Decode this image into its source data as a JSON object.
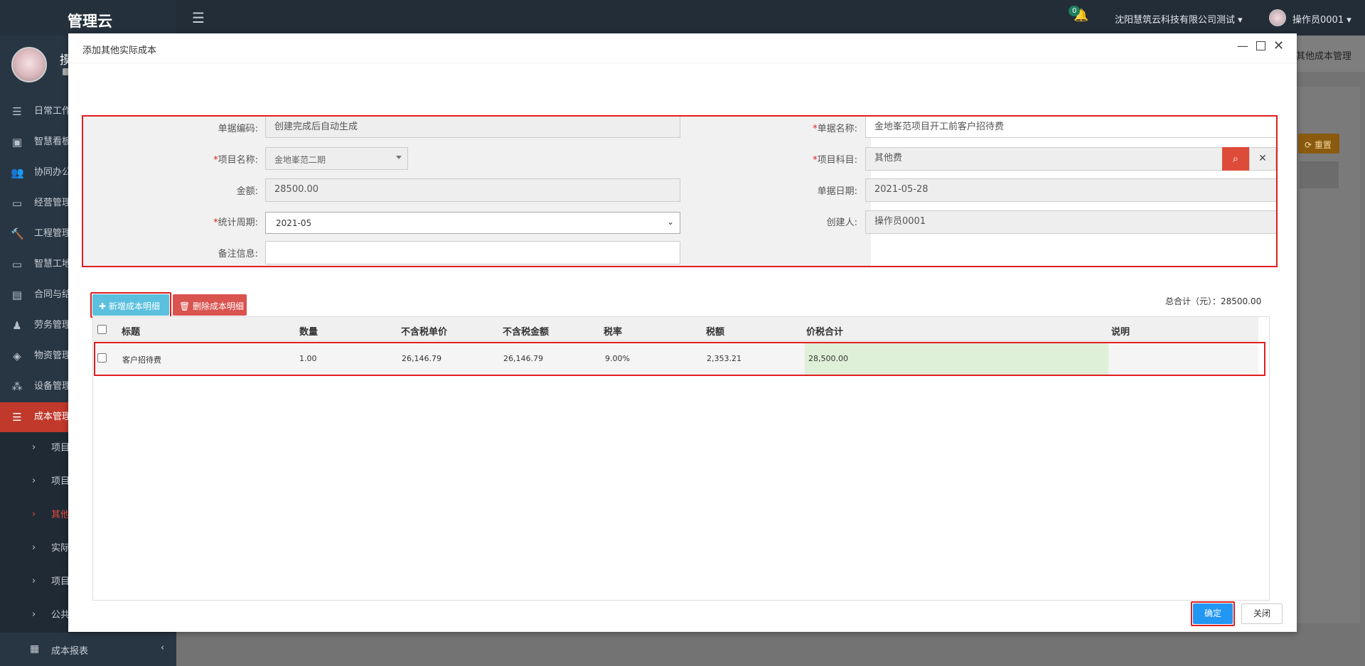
{
  "app": {
    "logo": "管理云"
  },
  "user_panel": {
    "name_fragment": "摸"
  },
  "header": {
    "notification_count": "0",
    "company": "沈阳慧筑云科技有限公司测试 ▾",
    "operator": "操作员0001 ▾"
  },
  "sidebar": {
    "items": [
      {
        "label": "日常工作",
        "icon": "list-icon"
      },
      {
        "label": "智慧看板",
        "icon": "dashboard-icon"
      },
      {
        "label": "协同办公",
        "icon": "users-icon"
      },
      {
        "label": "经营管理",
        "icon": "monitor-icon"
      },
      {
        "label": "工程管理",
        "icon": "hammer-icon"
      },
      {
        "label": "智慧工地",
        "icon": "monitor-icon"
      },
      {
        "label": "合同与结",
        "icon": "file-icon"
      },
      {
        "label": "劳务管理",
        "icon": "worker-icon"
      },
      {
        "label": "物资管理",
        "icon": "cube-icon"
      },
      {
        "label": "设备管理",
        "icon": "cubes-icon"
      },
      {
        "label": "成本管理",
        "icon": "list-icon"
      }
    ],
    "submenu": [
      {
        "label": "项目"
      },
      {
        "label": "项目"
      },
      {
        "label": "其他"
      },
      {
        "label": "实际"
      },
      {
        "label": "项目"
      },
      {
        "label": "公共"
      }
    ],
    "report": {
      "label": "成本报表",
      "chev": "‹"
    }
  },
  "background": {
    "tab_text": "其他成本管理",
    "reset_label": "⟳ 重置"
  },
  "modal": {
    "title": "添加其他实际成本",
    "form": {
      "doc_code_label": "单据编码:",
      "doc_code_value": "创建完成后自动生成",
      "doc_name_label": "单据名称:",
      "doc_name_value": "金地峯范项目开工前客户招待费",
      "project_label": "项目名称:",
      "project_value": "金地峯范二期",
      "subject_label": "项目科目:",
      "subject_value": "其他费",
      "amount_label": "金额:",
      "amount_value": "28500.00",
      "date_label": "单据日期:",
      "date_value": "2021-05-28",
      "period_label": "统计周期:",
      "period_value": "2021-05",
      "creator_label": "创建人:",
      "creator_value": "操作员0001",
      "remark_label": "备注信息:",
      "remark_value": ""
    },
    "detail": {
      "add_label": "✚ 新增成本明细",
      "delete_label": "🗑 删除成本明细",
      "total": "总合计（元）：28500.00",
      "columns": [
        "标题",
        "数量",
        "不含税单价",
        "不含税金额",
        "税率",
        "税额",
        "价税合计",
        "说明"
      ],
      "rows": [
        {
          "title": "客户招待费",
          "qty": "1.00",
          "unit_price": "26,146.79",
          "amount": "26,146.79",
          "rate": "9.00%",
          "tax": "2,353.21",
          "total": "28,500.00",
          "note": ""
        }
      ]
    },
    "footer": {
      "ok": "确定",
      "close": "关闭"
    }
  },
  "colors": {
    "danger": "#dd4b39",
    "info": "#5bc0de",
    "primary": "#2196f3",
    "sidebar": "#283644",
    "highlight_border": "#e01e1e"
  }
}
